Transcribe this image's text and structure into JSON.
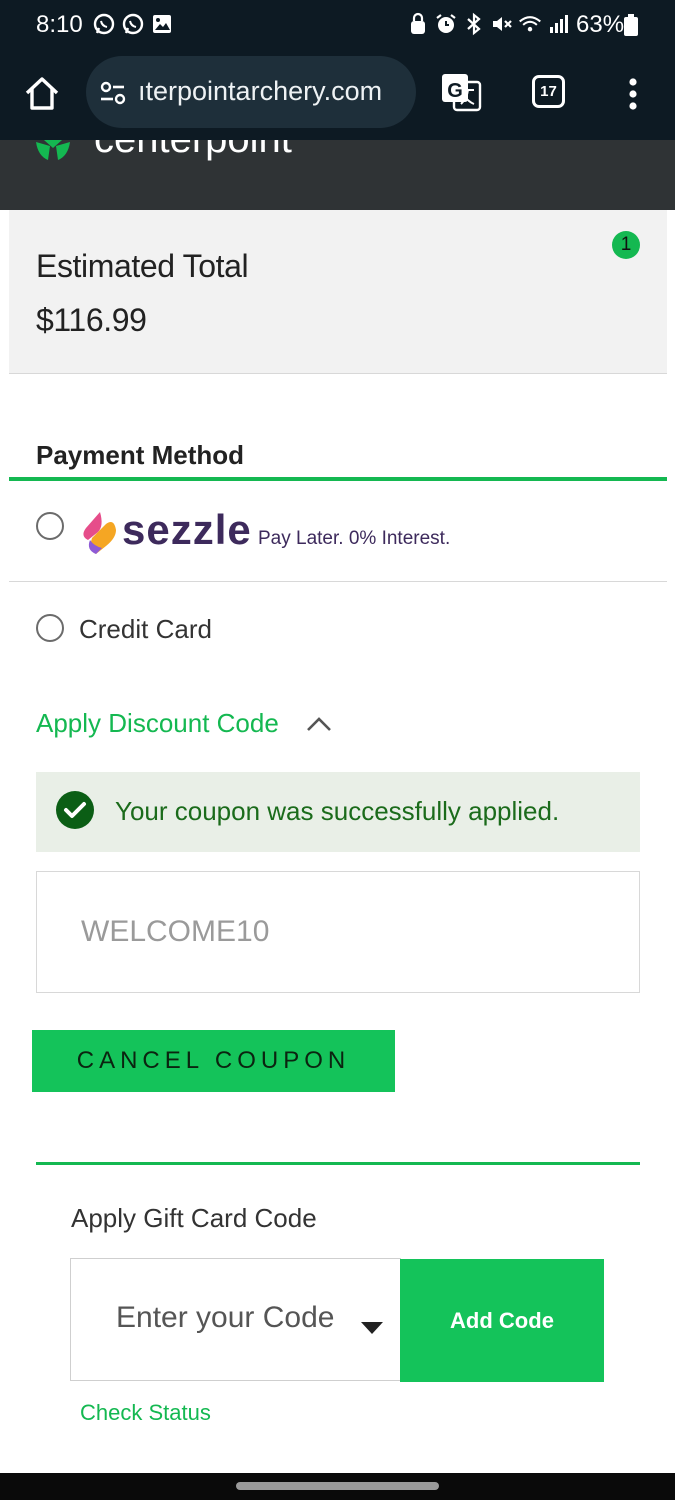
{
  "status_bar": {
    "time": "8:10",
    "battery_percent": "63%",
    "left_icons": [
      "whatsapp-icon",
      "whatsapp-icon",
      "gallery-icon"
    ],
    "right_icons": [
      "lock-icon",
      "alarm-icon",
      "bluetooth-icon",
      "mute-icon",
      "wifi-icon",
      "signal-icon",
      "battery-icon"
    ]
  },
  "browser": {
    "url": "ıterpointarchery.com",
    "tab_count": "17",
    "icons": [
      "home-icon",
      "site-settings-icon",
      "translate-icon",
      "tabs-icon",
      "menu-icon"
    ]
  },
  "site": {
    "logo_text": "centerpoint"
  },
  "summary": {
    "title": "Estimated Total",
    "total": "$116.99",
    "cart_count": "1"
  },
  "payment": {
    "heading": "Payment Method",
    "sezzle_word": "sezzle",
    "sezzle_tagline": "Pay Later. 0% Interest.",
    "credit_card_label": "Credit Card"
  },
  "discount": {
    "toggle_label": "Apply Discount Code",
    "success_message": "Your coupon was successfully applied.",
    "coupon_code": "WELCOME10",
    "cancel_label": "CANCEL COUPON"
  },
  "gift_card": {
    "heading": "Apply Gift Card Code",
    "placeholder": "Enter your Code",
    "add_label": "Add Code",
    "status_link": "Check Status"
  },
  "colors": {
    "brand_green": "#14b851",
    "button_green": "#14c35a",
    "chrome_dark": "#0d1a23",
    "header_dark": "#2f3335",
    "sezzle_purple": "#3d2a5c"
  }
}
